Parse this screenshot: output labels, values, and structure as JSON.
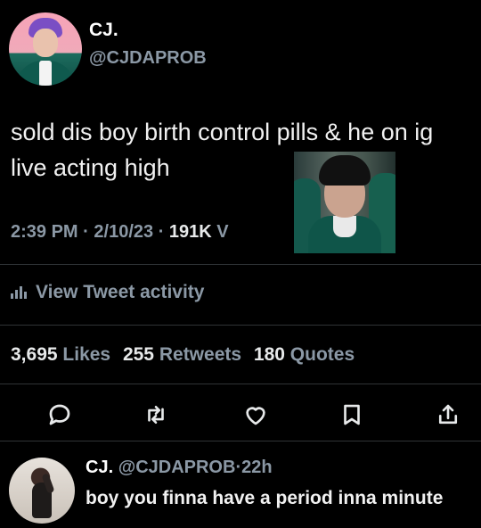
{
  "tweet": {
    "display_name": "CJ.",
    "handle": "@CJDAPROB",
    "text": "sold dis boy birth control pills & he on ig live acting high",
    "time": "2:39 PM",
    "date": "2/10/23",
    "separator": "·",
    "views": "191K",
    "views_partial": "V"
  },
  "activity": {
    "label": "View Tweet activity"
  },
  "stats": {
    "likes_count": "3,695",
    "likes_label": "Likes",
    "retweets_count": "255",
    "retweets_label": "Retweets",
    "quotes_count": "180",
    "quotes_label": "Quotes"
  },
  "actions": [
    "reply-icon",
    "retweet-icon",
    "like-icon",
    "bookmark-icon",
    "share-icon"
  ],
  "reply": {
    "display_name": "CJ.",
    "handle": "@CJDAPROB",
    "separator": "·",
    "time": "22h",
    "text": "boy you finna have a period inna minute"
  },
  "colors": {
    "background": "#000000",
    "text": "#e7e9ea",
    "muted": "#8b98a5",
    "divider": "#2f3336"
  }
}
